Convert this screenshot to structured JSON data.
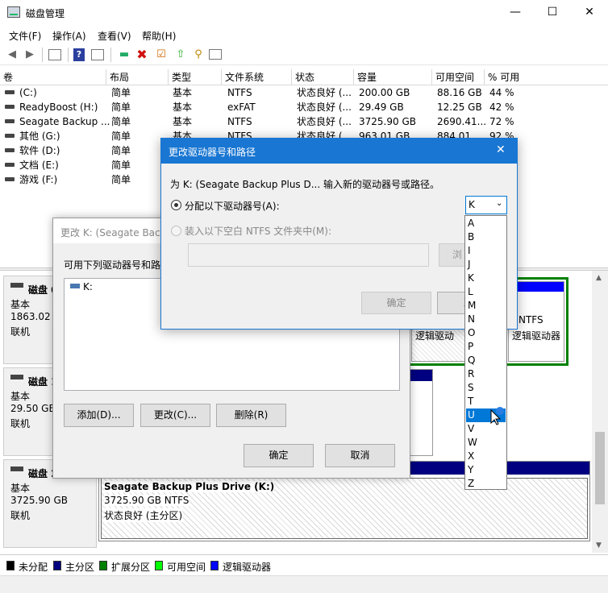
{
  "window": {
    "title": "磁盘管理",
    "minimize": "—",
    "maximize": "☐",
    "close": "✕"
  },
  "menu": [
    "文件(F)",
    "操作(A)",
    "查看(V)",
    "帮助(H)"
  ],
  "columns": [
    "卷",
    "布局",
    "类型",
    "文件系统",
    "状态",
    "容量",
    "可用空间",
    "% 可用"
  ],
  "volumes": [
    {
      "name": "(C:)",
      "layout": "简单",
      "type": "基本",
      "fs": "NTFS",
      "status": "状态良好 (...",
      "capacity": "200.00 GB",
      "free": "88.16 GB",
      "pct": "44 %"
    },
    {
      "name": "ReadyBoost (H:)",
      "layout": "简单",
      "type": "基本",
      "fs": "exFAT",
      "status": "状态良好 (...",
      "capacity": "29.49 GB",
      "free": "12.25 GB",
      "pct": "42 %"
    },
    {
      "name": "Seagate Backup ...",
      "layout": "简单",
      "type": "基本",
      "fs": "NTFS",
      "status": "状态良好 (...",
      "capacity": "3725.90 GB",
      "free": "2690.41...",
      "pct": "72 %"
    },
    {
      "name": "其他 (G:)",
      "layout": "简单",
      "type": "基本",
      "fs": "NTFS",
      "status": "状态良好 (...",
      "capacity": "963.01 GB",
      "free": "884.01 ...",
      "pct": "92 %"
    },
    {
      "name": "软件 (D:)",
      "layout": "简单",
      "type": "基本",
      "fs": "",
      "status": "",
      "capacity": "",
      "free": "",
      "pct": ""
    },
    {
      "name": "文档 (E:)",
      "layout": "简单",
      "type": "基本",
      "fs": "",
      "status": "",
      "capacity": "",
      "free": "",
      "pct": ""
    },
    {
      "name": "游戏 (F:)",
      "layout": "简单",
      "type": "基本",
      "fs": "",
      "status": "",
      "capacity": "",
      "free": "",
      "pct": ""
    }
  ],
  "disks": [
    {
      "name": "磁盘 0",
      "kind": "基本",
      "size": "1863.02 GB",
      "state": "联机"
    },
    {
      "name": "磁盘 1",
      "kind": "基本",
      "size": "29.50 GB",
      "state": "联机"
    },
    {
      "name": "磁盘 2",
      "kind": "基本",
      "size": "3725.90 GB",
      "state": "联机"
    }
  ],
  "disk_partitions": {
    "d0_a_label": "逻辑驱动",
    "d0_b_fs": "NTFS",
    "d0_b_label": "逻辑驱动器",
    "d2_name": "Seagate Backup Plus Drive  (K:)",
    "d2_size": "3725.90 GB NTFS",
    "d2_status": "状态良好 (主分区)"
  },
  "legend": [
    {
      "label": "未分配",
      "color": "#000000"
    },
    {
      "label": "主分区",
      "color": "#000080"
    },
    {
      "label": "扩展分区",
      "color": "#008000"
    },
    {
      "label": "可用空间",
      "color": "#00ff00"
    },
    {
      "label": "逻辑驱动器",
      "color": "#0000ff"
    }
  ],
  "back_dialog": {
    "title": "更改 K: (Seagate Back",
    "prompt": "可用下列驱动器号和路径",
    "list_item": "K:",
    "add": "添加(D)...",
    "change": "更改(C)...",
    "remove": "删除(R)",
    "ok": "确定",
    "cancel": "取消"
  },
  "front_dialog": {
    "title": "更改驱动器号和路径",
    "close": "✕",
    "instruction": "为 K: (Seagate Backup Plus D... 输入新的驱动器号或路径。",
    "radio_assign": "分配以下驱动器号(A):",
    "radio_mount": "装入以下空白 NTFS 文件夹中(M):",
    "selected_letter": "K",
    "browse": "浏",
    "ok": "确定",
    "cancel_partial": "耳"
  },
  "letters": [
    "A",
    "B",
    "I",
    "J",
    "K",
    "L",
    "M",
    "N",
    "O",
    "P",
    "Q",
    "R",
    "S",
    "T",
    "U",
    "V",
    "W",
    "X",
    "Y",
    "Z"
  ],
  "selected_index": 14
}
